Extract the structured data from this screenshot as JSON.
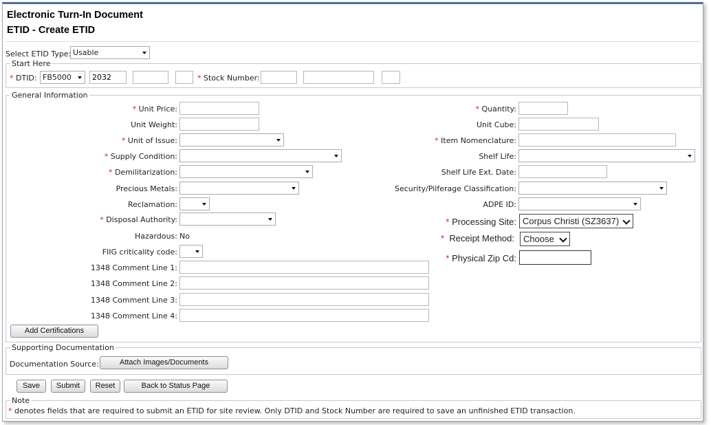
{
  "header": {
    "title_line1": "Electronic Turn-In Document",
    "title_line2": "ETID - Create ETID"
  },
  "etid_type": {
    "label": "Select ETID Type:",
    "value": "Usable"
  },
  "start_here": {
    "legend": "Start Here",
    "dtid_label": "DTID:",
    "dtid_select": "FB5000",
    "dtid_value2": "2032",
    "dtid_value3": "",
    "dtid_value4": "",
    "stock_label": "Stock Number:",
    "stock_value1": "",
    "stock_value2": "",
    "stock_value3": ""
  },
  "general": {
    "legend": "General Information",
    "unit_price_label": "Unit Price:",
    "unit_price_value": "",
    "unit_weight_label": "Unit Weight:",
    "unit_weight_value": "",
    "unit_of_issue_label": "Unit of Issue:",
    "unit_of_issue_value": "",
    "supply_condition_label": "Supply Condition:",
    "supply_condition_value": "",
    "demil_label": "Demilitarization:",
    "demil_value": "",
    "precious_metals_label": "Precious Metals:",
    "precious_metals_value": "",
    "reclamation_label": "Reclamation:",
    "reclamation_value": "",
    "disposal_authority_label": "Disposal Authority:",
    "disposal_authority_value": "",
    "hazardous_label": "Hazardous:",
    "hazardous_value": "No",
    "fiig_label": "FIIG criticality code:",
    "fiig_value": "",
    "comment1_label": "1348 Comment Line 1:",
    "comment1_value": "",
    "comment2_label": "1348 Comment Line 2:",
    "comment2_value": "",
    "comment3_label": "1348 Comment Line 3:",
    "comment3_value": "",
    "comment4_label": "1348 Comment Line 4:",
    "comment4_value": "",
    "quantity_label": "Quantity:",
    "quantity_value": "",
    "unit_cube_label": "Unit Cube:",
    "unit_cube_value": "",
    "item_nomenclature_label": "Item Nomenclature:",
    "item_nomenclature_value": "",
    "shelf_life_label": "Shelf Life:",
    "shelf_life_value": "",
    "shelf_life_ext_label": "Shelf Life Ext. Date:",
    "shelf_life_ext_value": "",
    "security_label": "Security/Pilferage Classification:",
    "security_value": "",
    "adpe_label": "ADPE ID:",
    "adpe_value": "",
    "processing_site_label": "Processing Site:",
    "processing_site_value": "Corpus Christi (SZ3637)",
    "receipt_method_label": "Receipt Method:",
    "receipt_method_value": "Choose",
    "zip_label": "Physical Zip Cd:",
    "zip_value": "",
    "add_certifications": "Add Certifications"
  },
  "supporting": {
    "legend": "Supporting Documentation",
    "source_label": "Documentation Source:",
    "attach_button": "Attach Images/Documents"
  },
  "actions": {
    "save": "Save",
    "submit": "Submit",
    "reset": "Reset",
    "back": "Back to Status Page"
  },
  "note": {
    "legend": "Note",
    "asterisk": "*",
    "text": "denotes fields that are required to submit an ETID for site review. Only DTID and Stock Number are required to save an unfinished ETID transaction."
  },
  "required_marker": "*"
}
